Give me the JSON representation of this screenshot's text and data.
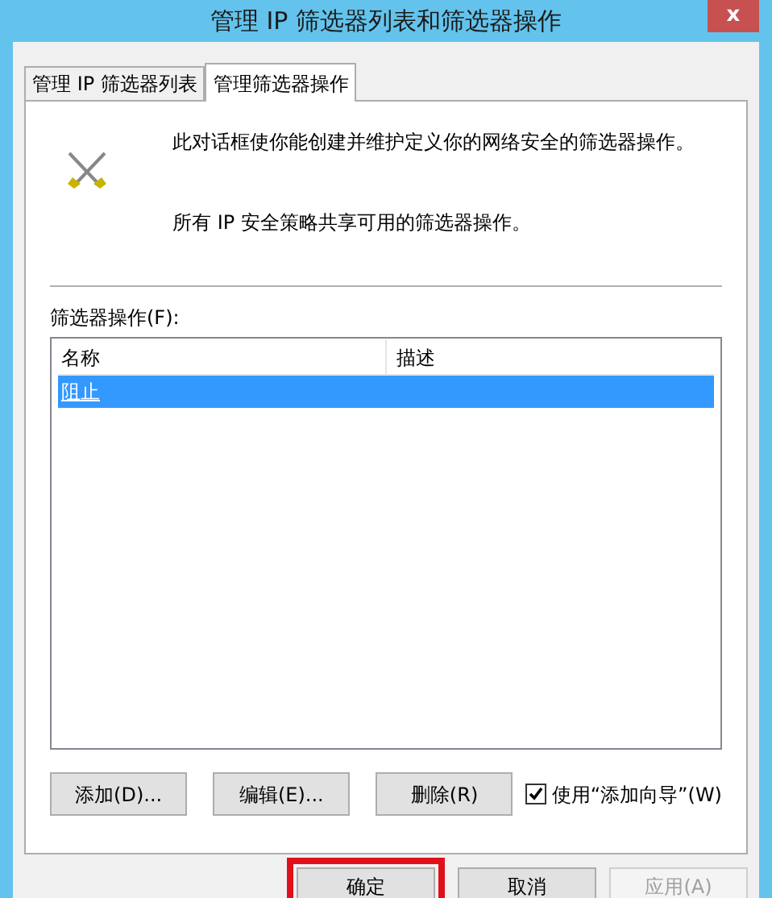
{
  "window": {
    "title": "管理 IP 筛选器列表和筛选器操作",
    "close": "x"
  },
  "tabs": [
    {
      "label": "管理 IP 筛选器列表",
      "selected": false
    },
    {
      "label": "管理筛选器操作",
      "selected": true
    }
  ],
  "intro": [
    "此对话框使你能创建并维护定义你的网络安全的筛选器操作。",
    "所有 IP 安全策略共享可用的筛选器操作。"
  ],
  "list": {
    "label": "筛选器操作(F):",
    "columns": [
      "名称",
      "描述"
    ],
    "rows": [
      {
        "name": "阻止",
        "selected": true
      }
    ]
  },
  "actions": [
    {
      "label": "添加(D)..."
    },
    {
      "label": "编辑(E)..."
    },
    {
      "label": "删除(R)"
    }
  ],
  "wizard": {
    "label": "使用“添加向导”(W)",
    "checked": true
  },
  "buttons": [
    {
      "label": "确定",
      "highlighted": true,
      "disabled": false
    },
    {
      "label": "取消",
      "highlighted": false,
      "disabled": false
    },
    {
      "label": "应用(A)",
      "highlighted": false,
      "disabled": true
    }
  ]
}
